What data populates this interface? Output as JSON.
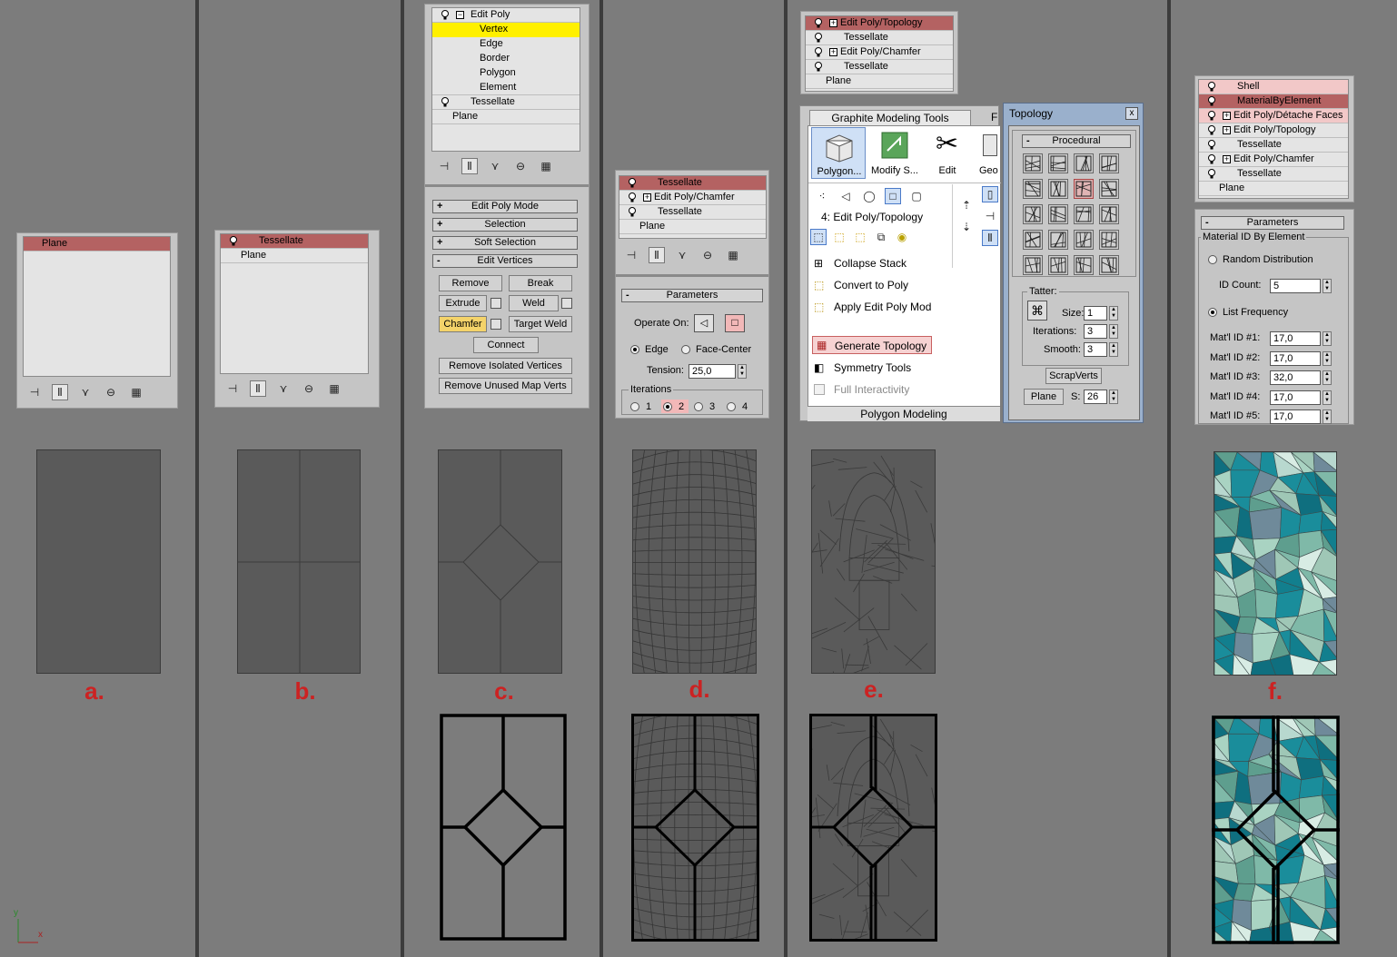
{
  "columns": {
    "a": {
      "stack": [
        "Plane"
      ],
      "letter": "a."
    },
    "b": {
      "stack": [
        "Tessellate",
        "Plane"
      ],
      "letter": "b."
    },
    "c": {
      "stack": [
        "Edit Poly",
        "Vertex",
        "Edge",
        "Border",
        "Polygon",
        "Element",
        "Tessellate",
        "Plane"
      ],
      "rollouts": {
        "edit_poly_mode": "Edit Poly Mode",
        "selection": "Selection",
        "soft_selection": "Soft Selection",
        "edit_vertices": "Edit Vertices"
      },
      "buttons": {
        "remove": "Remove",
        "break": "Break",
        "extrude": "Extrude",
        "weld": "Weld",
        "chamfer": "Chamfer",
        "target_weld": "Target Weld",
        "connect": "Connect",
        "remove_isolated": "Remove Isolated Vertices",
        "remove_unused": "Remove Unused Map Verts"
      },
      "letter": "c."
    },
    "d": {
      "stack": [
        "Tessellate",
        "Edit Poly/Chamfer",
        "Tessellate",
        "Plane"
      ],
      "parameters": "Parameters",
      "operate_on": "Operate On:",
      "edge": "Edge",
      "face_center": "Face-Center",
      "tension_label": "Tension:",
      "tension_value": "25,0",
      "iterations_label": "Iterations",
      "iter": [
        "1",
        "2",
        "3",
        "4"
      ],
      "letter": "d."
    },
    "e": {
      "stack": [
        "Edit Poly/Topology",
        "Tessellate",
        "Edit Poly/Chamfer",
        "Tessellate",
        "Plane"
      ],
      "gmt_tab": "Graphite Modeling Tools",
      "gmt_tab2": "F",
      "ribbon": [
        "Polygon...",
        "Modify S...",
        "Edit",
        "Geo"
      ],
      "mod_label": "4: Edit Poly/Topology",
      "menu": [
        "Collapse Stack",
        "Convert to Poly",
        "Apply Edit Poly Mod",
        "Generate Topology",
        "Symmetry Tools",
        "Full Interactivity"
      ],
      "footer": "Polygon Modeling",
      "topology": {
        "title": "Topology",
        "close": "x",
        "procedural": "Procedural",
        "tatter": "Tatter:",
        "size_label": "Size:",
        "size_value": "1",
        "iter_label": "Iterations:",
        "iter_value": "3",
        "smooth_label": "Smooth:",
        "smooth_value": "3",
        "scrapverts": "ScrapVerts",
        "plane": "Plane",
        "s_label": "S:",
        "s_value": "26"
      },
      "letter": "e."
    },
    "f": {
      "stack": [
        "Shell",
        "MaterialByElement",
        "Edit Poly/Détache Faces",
        "Edit Poly/Topology",
        "Tessellate",
        "Edit Poly/Chamfer",
        "Tessellate",
        "Plane"
      ],
      "parameters": "Parameters",
      "group": "Material ID By Element",
      "random": "Random Distribution",
      "id_count_label": "ID Count:",
      "id_count": "5",
      "list_freq": "List Frequency",
      "mat_ids": [
        {
          "label": "Mat'l ID #1:",
          "value": "17,0"
        },
        {
          "label": "Mat'l ID #2:",
          "value": "17,0"
        },
        {
          "label": "Mat'l ID #3:",
          "value": "32,0"
        },
        {
          "label": "Mat'l ID #4:",
          "value": "17,0"
        },
        {
          "label": "Mat'l ID #5:",
          "value": "17,0"
        }
      ],
      "letter": "f."
    }
  },
  "axis": {
    "y": "y",
    "x": "x"
  },
  "colors": {
    "background": "#7c7c7c",
    "selected_row": "#b46262",
    "highlight": "#fff000",
    "letter": "#cc2222",
    "teal": "#127f8e"
  }
}
